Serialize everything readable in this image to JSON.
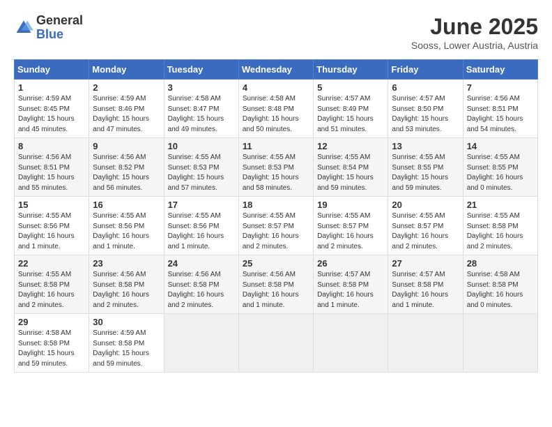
{
  "header": {
    "logo_general": "General",
    "logo_blue": "Blue",
    "month_title": "June 2025",
    "location": "Sooss, Lower Austria, Austria"
  },
  "calendar": {
    "headers": [
      "Sunday",
      "Monday",
      "Tuesday",
      "Wednesday",
      "Thursday",
      "Friday",
      "Saturday"
    ],
    "weeks": [
      [
        {
          "day": "1",
          "lines": [
            "Sunrise: 4:59 AM",
            "Sunset: 8:45 PM",
            "Daylight: 15 hours",
            "and 45 minutes."
          ]
        },
        {
          "day": "2",
          "lines": [
            "Sunrise: 4:59 AM",
            "Sunset: 8:46 PM",
            "Daylight: 15 hours",
            "and 47 minutes."
          ]
        },
        {
          "day": "3",
          "lines": [
            "Sunrise: 4:58 AM",
            "Sunset: 8:47 PM",
            "Daylight: 15 hours",
            "and 49 minutes."
          ]
        },
        {
          "day": "4",
          "lines": [
            "Sunrise: 4:58 AM",
            "Sunset: 8:48 PM",
            "Daylight: 15 hours",
            "and 50 minutes."
          ]
        },
        {
          "day": "5",
          "lines": [
            "Sunrise: 4:57 AM",
            "Sunset: 8:49 PM",
            "Daylight: 15 hours",
            "and 51 minutes."
          ]
        },
        {
          "day": "6",
          "lines": [
            "Sunrise: 4:57 AM",
            "Sunset: 8:50 PM",
            "Daylight: 15 hours",
            "and 53 minutes."
          ]
        },
        {
          "day": "7",
          "lines": [
            "Sunrise: 4:56 AM",
            "Sunset: 8:51 PM",
            "Daylight: 15 hours",
            "and 54 minutes."
          ]
        }
      ],
      [
        {
          "day": "8",
          "lines": [
            "Sunrise: 4:56 AM",
            "Sunset: 8:51 PM",
            "Daylight: 15 hours",
            "and 55 minutes."
          ]
        },
        {
          "day": "9",
          "lines": [
            "Sunrise: 4:56 AM",
            "Sunset: 8:52 PM",
            "Daylight: 15 hours",
            "and 56 minutes."
          ]
        },
        {
          "day": "10",
          "lines": [
            "Sunrise: 4:55 AM",
            "Sunset: 8:53 PM",
            "Daylight: 15 hours",
            "and 57 minutes."
          ]
        },
        {
          "day": "11",
          "lines": [
            "Sunrise: 4:55 AM",
            "Sunset: 8:53 PM",
            "Daylight: 15 hours",
            "and 58 minutes."
          ]
        },
        {
          "day": "12",
          "lines": [
            "Sunrise: 4:55 AM",
            "Sunset: 8:54 PM",
            "Daylight: 15 hours",
            "and 59 minutes."
          ]
        },
        {
          "day": "13",
          "lines": [
            "Sunrise: 4:55 AM",
            "Sunset: 8:55 PM",
            "Daylight: 15 hours",
            "and 59 minutes."
          ]
        },
        {
          "day": "14",
          "lines": [
            "Sunrise: 4:55 AM",
            "Sunset: 8:55 PM",
            "Daylight: 16 hours",
            "and 0 minutes."
          ]
        }
      ],
      [
        {
          "day": "15",
          "lines": [
            "Sunrise: 4:55 AM",
            "Sunset: 8:56 PM",
            "Daylight: 16 hours",
            "and 1 minute."
          ]
        },
        {
          "day": "16",
          "lines": [
            "Sunrise: 4:55 AM",
            "Sunset: 8:56 PM",
            "Daylight: 16 hours",
            "and 1 minute."
          ]
        },
        {
          "day": "17",
          "lines": [
            "Sunrise: 4:55 AM",
            "Sunset: 8:56 PM",
            "Daylight: 16 hours",
            "and 1 minute."
          ]
        },
        {
          "day": "18",
          "lines": [
            "Sunrise: 4:55 AM",
            "Sunset: 8:57 PM",
            "Daylight: 16 hours",
            "and 2 minutes."
          ]
        },
        {
          "day": "19",
          "lines": [
            "Sunrise: 4:55 AM",
            "Sunset: 8:57 PM",
            "Daylight: 16 hours",
            "and 2 minutes."
          ]
        },
        {
          "day": "20",
          "lines": [
            "Sunrise: 4:55 AM",
            "Sunset: 8:57 PM",
            "Daylight: 16 hours",
            "and 2 minutes."
          ]
        },
        {
          "day": "21",
          "lines": [
            "Sunrise: 4:55 AM",
            "Sunset: 8:58 PM",
            "Daylight: 16 hours",
            "and 2 minutes."
          ]
        }
      ],
      [
        {
          "day": "22",
          "lines": [
            "Sunrise: 4:55 AM",
            "Sunset: 8:58 PM",
            "Daylight: 16 hours",
            "and 2 minutes."
          ]
        },
        {
          "day": "23",
          "lines": [
            "Sunrise: 4:56 AM",
            "Sunset: 8:58 PM",
            "Daylight: 16 hours",
            "and 2 minutes."
          ]
        },
        {
          "day": "24",
          "lines": [
            "Sunrise: 4:56 AM",
            "Sunset: 8:58 PM",
            "Daylight: 16 hours",
            "and 2 minutes."
          ]
        },
        {
          "day": "25",
          "lines": [
            "Sunrise: 4:56 AM",
            "Sunset: 8:58 PM",
            "Daylight: 16 hours",
            "and 1 minute."
          ]
        },
        {
          "day": "26",
          "lines": [
            "Sunrise: 4:57 AM",
            "Sunset: 8:58 PM",
            "Daylight: 16 hours",
            "and 1 minute."
          ]
        },
        {
          "day": "27",
          "lines": [
            "Sunrise: 4:57 AM",
            "Sunset: 8:58 PM",
            "Daylight: 16 hours",
            "and 1 minute."
          ]
        },
        {
          "day": "28",
          "lines": [
            "Sunrise: 4:58 AM",
            "Sunset: 8:58 PM",
            "Daylight: 16 hours",
            "and 0 minutes."
          ]
        }
      ],
      [
        {
          "day": "29",
          "lines": [
            "Sunrise: 4:58 AM",
            "Sunset: 8:58 PM",
            "Daylight: 15 hours",
            "and 59 minutes."
          ]
        },
        {
          "day": "30",
          "lines": [
            "Sunrise: 4:59 AM",
            "Sunset: 8:58 PM",
            "Daylight: 15 hours",
            "and 59 minutes."
          ]
        },
        null,
        null,
        null,
        null,
        null
      ]
    ]
  }
}
